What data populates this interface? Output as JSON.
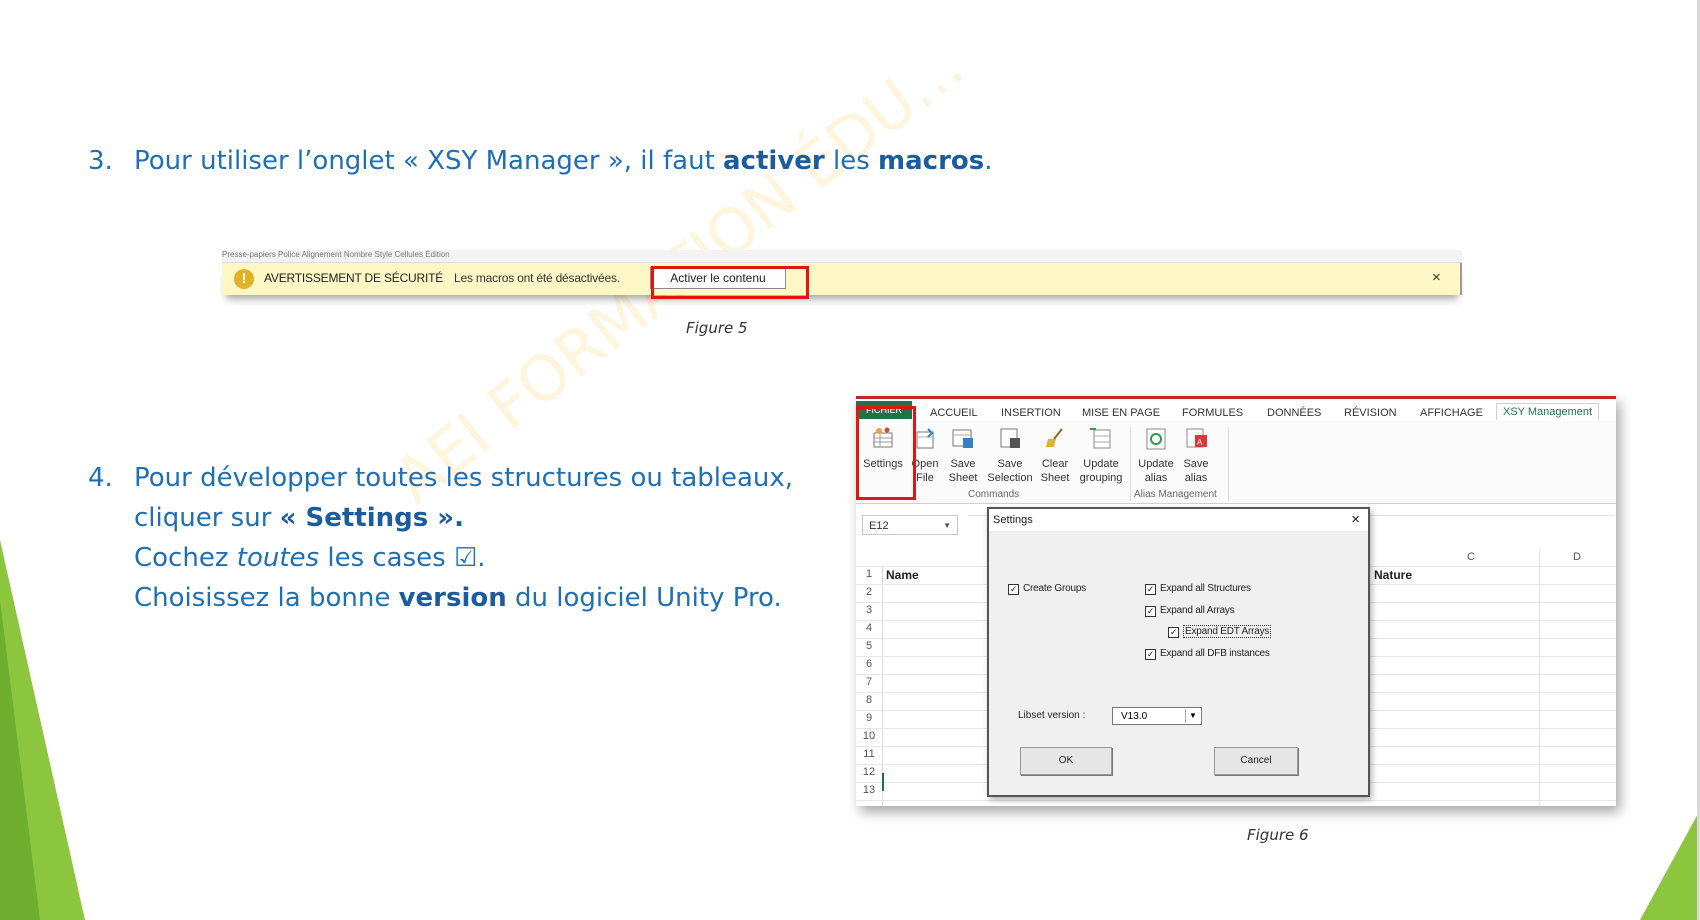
{
  "step3": {
    "num": "3.",
    "t1": "Pour utiliser l’onglet « XSY Manager », il faut ",
    "b1": "activer",
    "t2": " les ",
    "b2": "macros",
    "t3": "."
  },
  "step4": {
    "num": "4.",
    "line1": "Pour développer toutes les structures ou tableaux,",
    "line2_a": "cliquer sur ",
    "line2_b": "« Settings ».",
    "line3_a": "Cochez ",
    "line3_i": "toutes",
    "line3_b": " les cases ☑.",
    "line4_a": "Choisissez la bonne ",
    "line4_b": "version",
    "line4_c": " du logiciel Unity Pro."
  },
  "figure5": {
    "strip_text": "Presse-papiers   Police   Alignement   Nombre   Style   Cellules   Édition",
    "warning_icon": "warning-icon",
    "security_title": "AVERTISSEMENT DE SÉCURITÉ",
    "message": "Les macros ont été désactivées.",
    "enable_button": "Activer le contenu",
    "close": "×",
    "caption": "Figure 5"
  },
  "figure6": {
    "tabs": [
      "FICHIER",
      "ACCUEIL",
      "INSERTION",
      "MISE EN PAGE",
      "FORMULES",
      "DONNÉES",
      "RÉVISION",
      "AFFICHAGE",
      "XSY Management"
    ],
    "ribbon": {
      "settings": "Settings",
      "open_1": "Open",
      "open_2": "File",
      "save_sheet_1": "Save",
      "save_sheet_2": "Sheet",
      "save_sel_1": "Save",
      "save_sel_2": "Selection",
      "clear_1": "Clear",
      "clear_2": "Sheet",
      "update_grp_1": "Update",
      "update_grp_2": "grouping",
      "update_alias_1": "Update",
      "update_alias_2": "alias",
      "save_alias_1": "Save",
      "save_alias_2": "alias",
      "group_commands": "Commands",
      "group_alias": "Alias Management"
    },
    "name_box": "E12",
    "col_c": "C",
    "col_d": "D",
    "header_name": "Name",
    "header_nature": "Nature",
    "rows": [
      "1",
      "2",
      "3",
      "4",
      "5",
      "6",
      "7",
      "8",
      "9",
      "10",
      "11",
      "12",
      "13"
    ],
    "dialog": {
      "title": "Settings",
      "close": "×",
      "create_groups": "Create Groups",
      "expand_structures": "Expand all Structures",
      "expand_arrays": "Expand all Arrays",
      "expand_edt": "Expand EDT Arrays",
      "expand_dfb": "Expand all DFB instances",
      "check_mark": "✓",
      "libset_label": "Libset version :",
      "libset_value": "V13.0",
      "ok": "OK",
      "cancel": "Cancel"
    },
    "caption": "Figure 6"
  },
  "watermark": "AEI    FORMATION ÉDU...",
  "colors": {
    "text_blue": "#1f6fb5",
    "accent_green": "#8cc63f",
    "highlight_red": "#e01515",
    "excel_green": "#217346"
  }
}
